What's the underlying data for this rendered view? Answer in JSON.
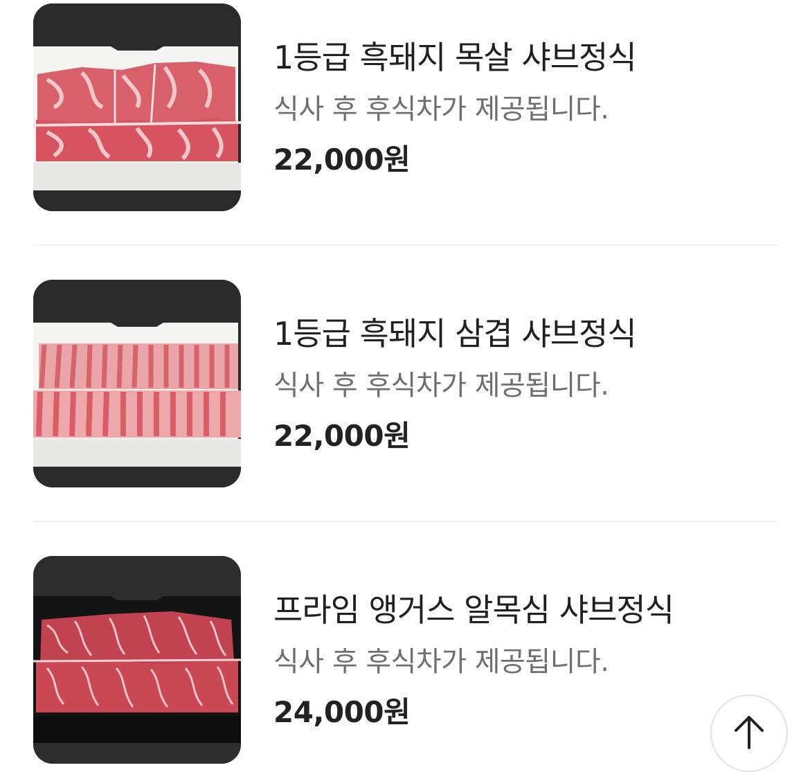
{
  "menu": {
    "items": [
      {
        "title": "1등급 흑돼지 목살 샤브정식",
        "description": "식사 후 후식차가 제공됩니다.",
        "price": "22,000원",
        "image": "pork-neck-slices"
      },
      {
        "title": "1등급 흑돼지 삼겹 샤브정식",
        "description": "식사 후 후식차가 제공됩니다.",
        "price": "22,000원",
        "image": "pork-belly-slices"
      },
      {
        "title": "프라임 앵거스 알목심 샤브정식",
        "description": "식사 후 후식차가 제공됩니다.",
        "price": "24,000원",
        "image": "angus-chuck-slices"
      }
    ]
  },
  "scroll_top": {
    "icon": "arrow-up-icon"
  },
  "colors": {
    "title": "#202020",
    "description": "#6f6f6f",
    "price": "#222222",
    "divider": "#efefef"
  }
}
